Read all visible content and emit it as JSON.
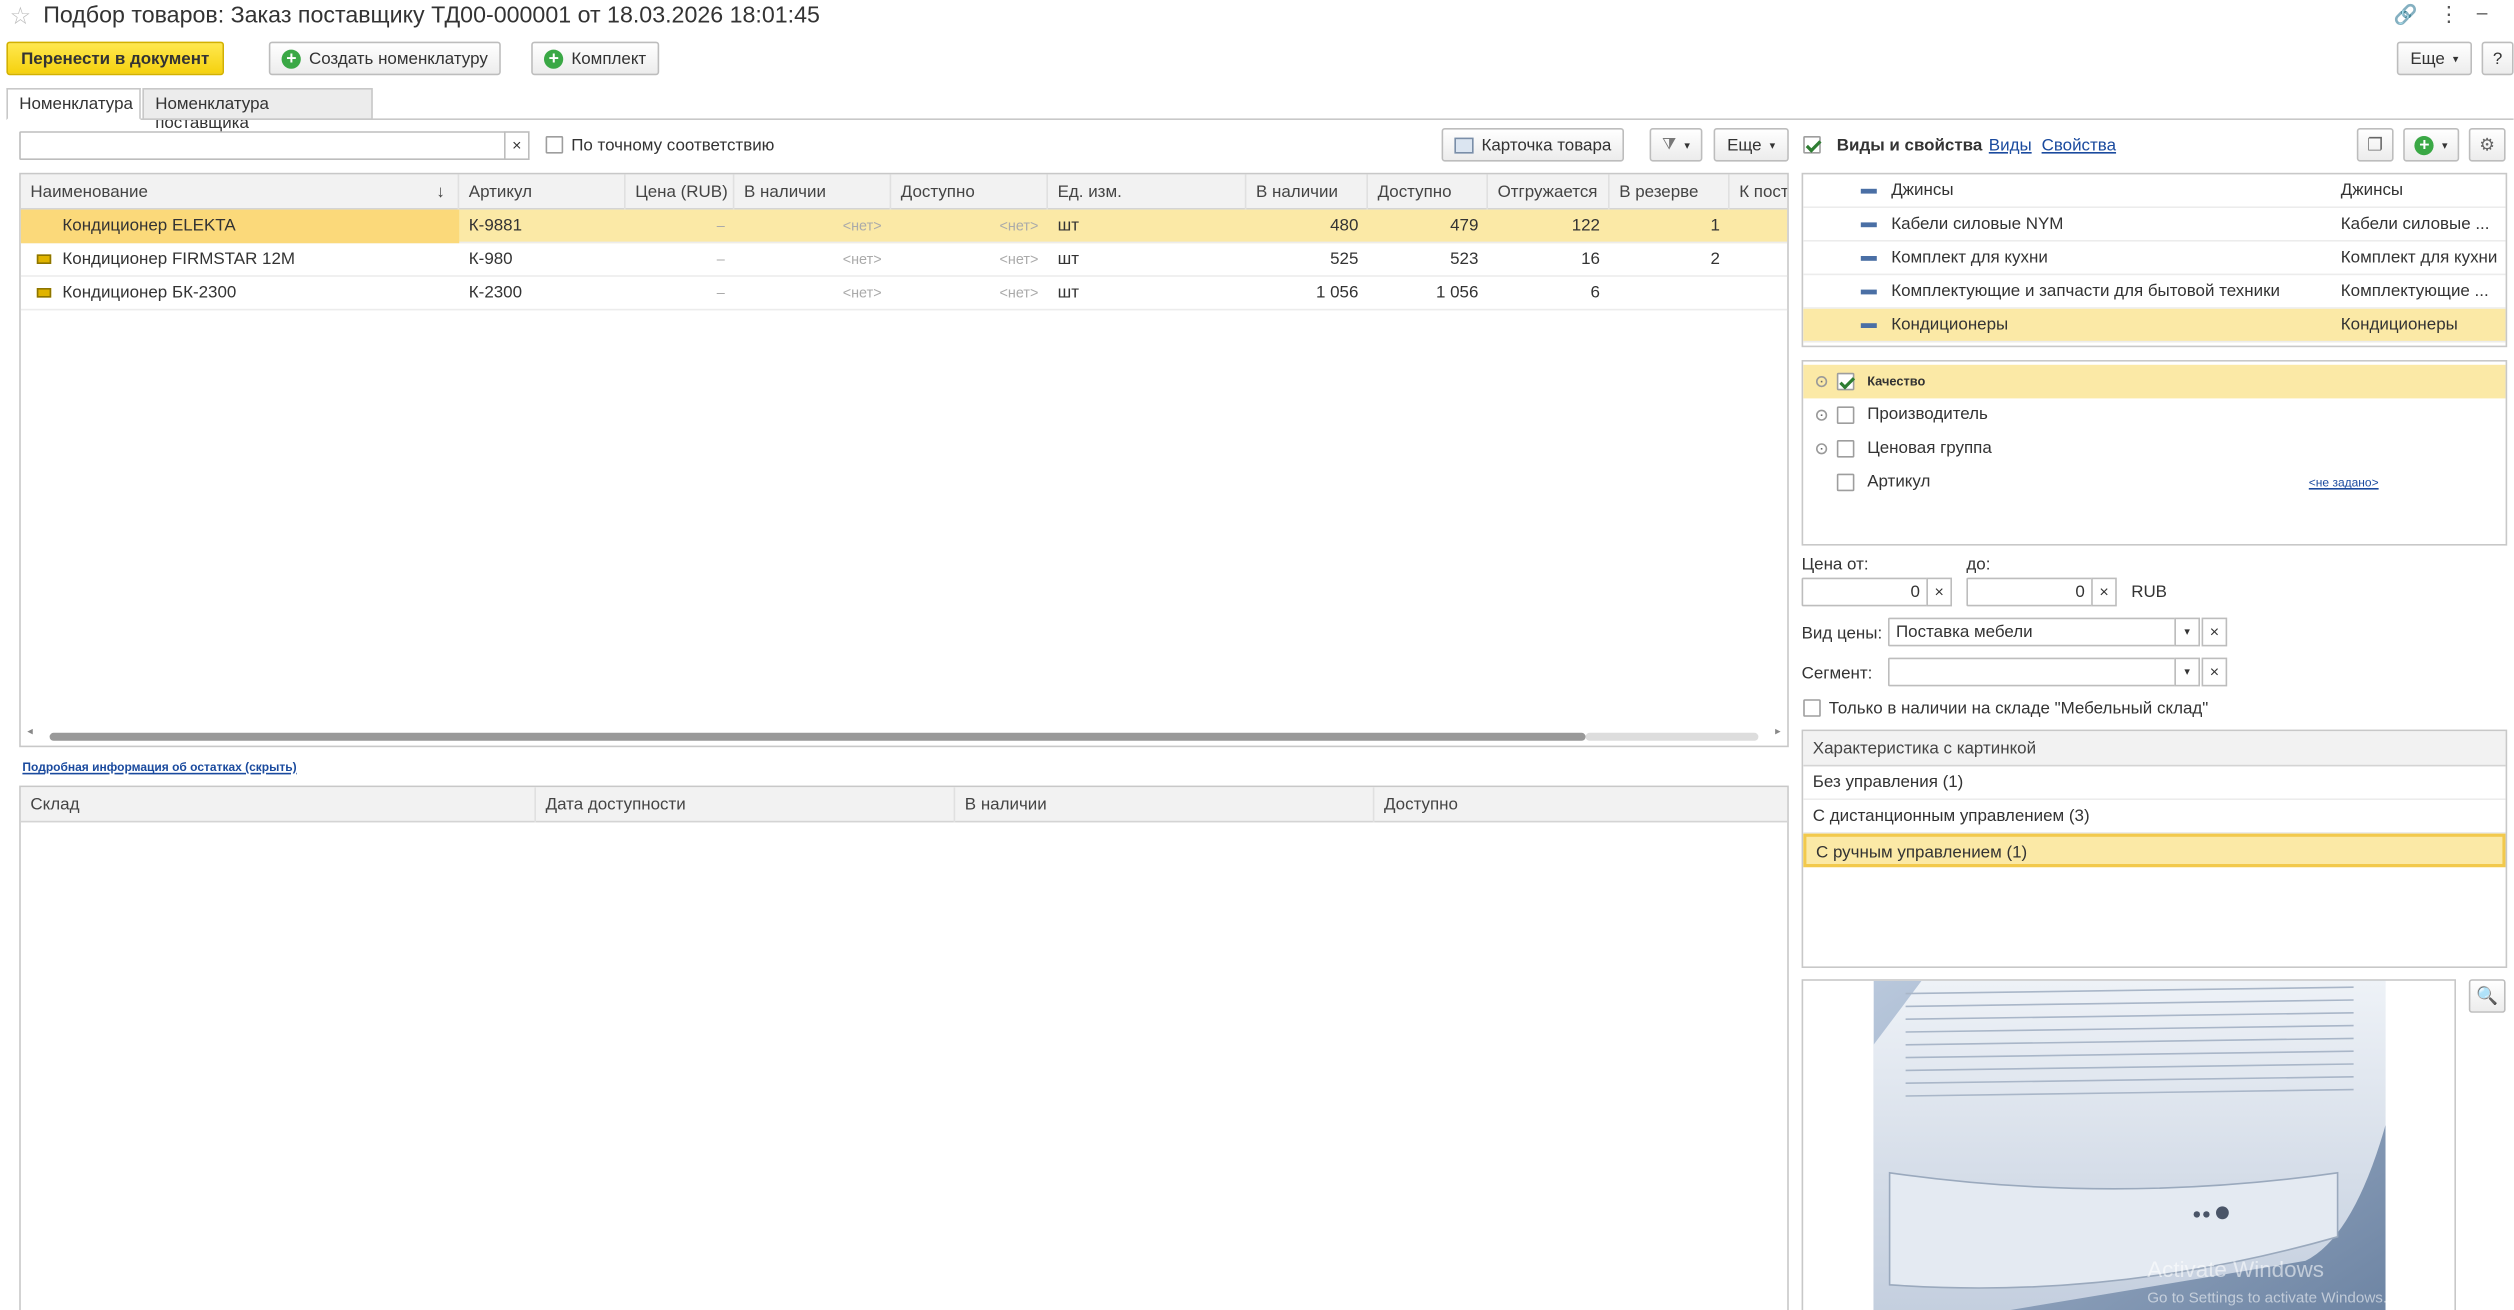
{
  "window": {
    "title": "Подбор товаров: Заказ поставщику ТД00-000001 от 18.03.2026 18:01:45"
  },
  "toolbar": {
    "transfer": "Перенести в документ",
    "create_nom": "Создать номенклатуру",
    "kit": "Комплект",
    "more": "Еще",
    "help": "?"
  },
  "tabs": [
    "Номенклатура",
    "Номенклатура поставщика"
  ],
  "search": {
    "value": "",
    "exact_match": "По точному соответствию",
    "product_card": "Карточка товара",
    "more": "Еще"
  },
  "table": {
    "headers": [
      "Наименование",
      "Артикул",
      "Цена (RUB)",
      "В наличии",
      "Доступно",
      "Ед. изм.",
      "В наличии",
      "Доступно",
      "Отгружается",
      "В резерве",
      "К пост"
    ],
    "rows": [
      {
        "name": "Кондиционер ELEKTA",
        "article": "К-9881",
        "price": "–",
        "avail1": "<нет>",
        "access1": "<нет>",
        "unit": "шт",
        "avail2": "480",
        "access2": "479",
        "shipping": "122",
        "reserve": "1",
        "topost": ""
      },
      {
        "name": "Кондиционер FIRMSTAR 12M",
        "article": "К-980",
        "price": "–",
        "avail1": "<нет>",
        "access1": "<нет>",
        "unit": "шт",
        "avail2": "525",
        "access2": "523",
        "shipping": "16",
        "reserve": "2",
        "topost": ""
      },
      {
        "name": "Кондиционер БК-2300",
        "article": "К-2300",
        "price": "–",
        "avail1": "<нет>",
        "access1": "<нет>",
        "unit": "шт",
        "avail2": "1 056",
        "access2": "1 056",
        "shipping": "6",
        "reserve": "",
        "topost": ""
      }
    ]
  },
  "stock": {
    "link": "Подробная информация об остатках (скрыть)",
    "headers": [
      "Склад",
      "Дата доступности",
      "В наличии",
      "Доступно"
    ]
  },
  "right": {
    "kinds_label": "Виды и свойства",
    "kinds_link": "Виды",
    "props_link": "Свойства",
    "kinds": [
      {
        "name": "Джинсы",
        "value": "Джинсы"
      },
      {
        "name": "Кабели силовые NYM",
        "value": "Кабели силовые ..."
      },
      {
        "name": "Комплект для кухни",
        "value": "Комплект для кухни"
      },
      {
        "name": "Комплектующие и запчасти для бытовой техники",
        "value": "Комплектующие ..."
      },
      {
        "name": "Кондиционеры",
        "value": "Кондиционеры"
      }
    ],
    "props": [
      {
        "name": "Качество",
        "checked": true,
        "value": ""
      },
      {
        "name": "Производитель",
        "checked": false,
        "value": ""
      },
      {
        "name": "Ценовая группа",
        "checked": false,
        "value": ""
      },
      {
        "name": "Артикул",
        "checked": false,
        "value": "<не задано>"
      }
    ],
    "price_from_label": "Цена от:",
    "price_to_label": "до:",
    "price_from": "0",
    "price_to": "0",
    "currency": "RUB",
    "price_kind_label": "Вид цены:",
    "price_kind": "Поставка мебели",
    "segment_label": "Сегмент:",
    "segment": "",
    "only_stock": "Только в наличии на складе \"Мебельный склад\"",
    "char_header": "Характеристика с картинкой",
    "chars": [
      "Без управления (1)",
      "С дистанционным управлением (3)",
      "С ручным управлением (1)"
    ],
    "watermark1": "Activate Windows",
    "watermark2": "Go to Settings to activate Windows."
  }
}
